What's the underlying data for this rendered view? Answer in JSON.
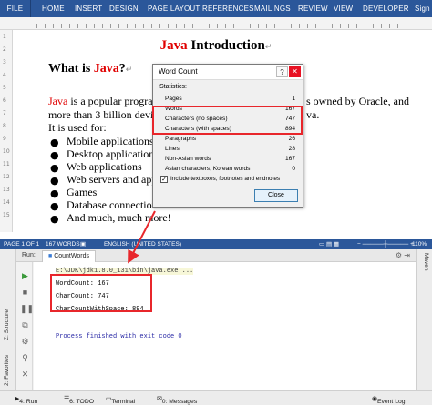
{
  "word": {
    "ribbon_tabs": [
      "FILE",
      "HOME",
      "INSERT",
      "DESIGN",
      "PAGE LAYOUT",
      "REFERENCES",
      "MAILINGS",
      "REVIEW",
      "VIEW",
      "DEVELOPER",
      "Sign"
    ],
    "title_red": "Java",
    "title_rest": " Introduction",
    "heading_prefix": "What is ",
    "heading_red": "Java",
    "heading_suffix": "?",
    "para_red": "Java",
    "para_line1": " is a popular program",
    "para_line1_end": "s owned by Oracle, and",
    "para_line2": "more than 3 billion device",
    "para_line2_end": "va.",
    "para_line3": "It is used for:",
    "bullets": [
      "Mobile applications (",
      "Desktop applications",
      "Web applications",
      "Web servers and appl",
      "Games",
      "Database connection",
      "And much, much more!"
    ],
    "ruler_numbers": [
      "1",
      "2",
      "3",
      "4",
      "5",
      "6",
      "7",
      "8",
      "9",
      "10",
      "11",
      "12",
      "13",
      "14",
      "15"
    ],
    "status_page": "PAGE 1 OF 1",
    "status_words": "167 WORDS",
    "status_lang": "ENGLISH (UNITED STATES)",
    "status_zoom": "110%"
  },
  "dialog": {
    "title": "Word Count",
    "help": "?",
    "close_x": "✕",
    "statistics_label": "Statistics:",
    "rows": [
      {
        "label": "Pages",
        "value": "1"
      },
      {
        "label": "Words",
        "value": "167"
      },
      {
        "label": "Characters (no spaces)",
        "value": "747"
      },
      {
        "label": "Characters (with spaces)",
        "value": "894"
      },
      {
        "label": "Paragraphs",
        "value": "26"
      },
      {
        "label": "Lines",
        "value": "28"
      },
      {
        "label": "Non-Asian words",
        "value": "167"
      },
      {
        "label": "Asian characters, Korean words",
        "value": "0"
      }
    ],
    "checkbox_label": "Include textboxes, footnotes and endnotes",
    "close_button": "Close"
  },
  "ide": {
    "run_label": "Run:",
    "tab_label": "CountWords",
    "left_vertical": [
      "Z: Structure",
      "2: Favorites"
    ],
    "right_vertical": "Maven",
    "console_lines": [
      "E:\\JDK\\jdk1.8.0_131\\bin\\java.exe ...",
      "WordCount: 167",
      "CharCount: 747",
      "CharCountWithSpace: 894",
      "Process finished with exit code 0"
    ],
    "bottom": {
      "run": "4: Run",
      "todo": "6: TODO",
      "terminal": "Terminal",
      "messages": "0: Messages",
      "eventlog": "Event Log"
    }
  },
  "colors": {
    "word_blue": "#2b579a",
    "highlight_red": "#e8262b",
    "java_red": "#e00000"
  }
}
